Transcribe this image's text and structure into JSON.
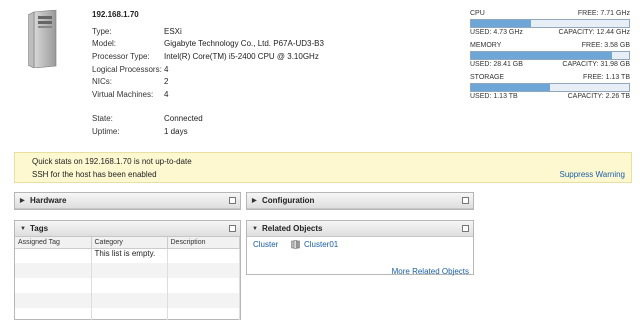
{
  "host": {
    "title": "192.168.1.70",
    "properties": [
      {
        "key": "Type:",
        "value": "ESXi"
      },
      {
        "key": "Model:",
        "value": "Gigabyte Technology Co., Ltd. P67A-UD3-B3"
      },
      {
        "key": "Processor Type:",
        "value": "Intel(R) Core(TM) i5-2400 CPU @ 3.10GHz"
      },
      {
        "key": "Logical Processors:",
        "value": "4"
      },
      {
        "key": "NICs:",
        "value": "2"
      },
      {
        "key": "Virtual Machines:",
        "value": "4"
      }
    ],
    "status": [
      {
        "key": "State:",
        "value": "Connected"
      },
      {
        "key": "Uptime:",
        "value": "1 days"
      }
    ]
  },
  "resources": [
    {
      "name": "CPU",
      "free": "FREE: 7.71 GHz",
      "used": "USED: 4.73 GHz",
      "capacity": "CAPACITY: 12.44 GHz",
      "fraction": 0.38
    },
    {
      "name": "MEMORY",
      "free": "FREE: 3.58 GB",
      "used": "USED: 28.41 GB",
      "capacity": "CAPACITY: 31.98 GB",
      "fraction": 0.89
    },
    {
      "name": "STORAGE",
      "free": "FREE: 1.13 TB",
      "used": "USED: 1.13 TB",
      "capacity": "CAPACITY: 2.26 TB",
      "fraction": 0.5
    }
  ],
  "alert": {
    "line1": "Quick stats on 192.168.1.70 is not up-to-date",
    "line2": "SSH for the host has been enabled",
    "action": "Suppress Warning"
  },
  "panels": {
    "hardware": "Hardware",
    "configuration": "Configuration",
    "tags": "Tags",
    "related": "Related Objects"
  },
  "tags_table": {
    "columns": [
      "Assigned Tag",
      "Category",
      "Description"
    ],
    "empty_text": "This list is empty."
  },
  "related_objects": {
    "key": "Cluster",
    "value": "Cluster01",
    "more": "More Related Objects"
  },
  "colors": {
    "bar_fill": "#6fa6d8",
    "alert_bg": "#fdf8d0",
    "link": "#1a5ea8"
  }
}
